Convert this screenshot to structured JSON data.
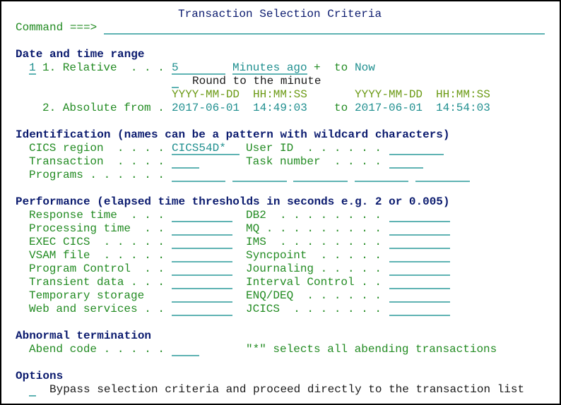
{
  "title": "Transaction Selection Criteria",
  "command": {
    "label": "Command ===>",
    "value": ""
  },
  "date_time_range": {
    "heading": "Date and time range",
    "selected_option": "1",
    "relative": {
      "label": "1. Relative  . . .",
      "amount": "5",
      "unit": "Minutes ago",
      "plus": "+",
      "to": "to",
      "now": "Now",
      "round_value": "",
      "round_label": "Round to the minute"
    },
    "formats": {
      "date": "YYYY-MM-DD",
      "time": "HH:MM:SS"
    },
    "absolute": {
      "label": "2. Absolute from .",
      "from_date": "2017-06-01",
      "from_time": "14:49:03",
      "to": "to",
      "to_date": "2017-06-01",
      "to_time": "14:54:03"
    }
  },
  "identification": {
    "heading": "Identification (names can be a pattern with wildcard characters)",
    "cics_region": {
      "label": "CICS region  . . . .",
      "value": "CICS54D*"
    },
    "user_id": {
      "label": "User ID  . . . . . .",
      "value": ""
    },
    "transaction": {
      "label": "Transaction  . . . .",
      "value": ""
    },
    "task_number": {
      "label": "Task number  . . . .",
      "value": ""
    },
    "programs": {
      "label": "Programs . . . . . .",
      "values": [
        "",
        "",
        "",
        "",
        ""
      ]
    }
  },
  "performance": {
    "heading": "Performance (elapsed time thresholds in seconds e.g. 2 or 0.005)",
    "left": [
      {
        "label": "Response time  . . .",
        "value": ""
      },
      {
        "label": "Processing time  . .",
        "value": ""
      },
      {
        "label": "EXEC CICS  . . . . .",
        "value": ""
      },
      {
        "label": "VSAM file  . . . . .",
        "value": ""
      },
      {
        "label": "Program Control  . .",
        "value": ""
      },
      {
        "label": "Transient data . . .",
        "value": ""
      },
      {
        "label": "Temporary storage",
        "value": ""
      },
      {
        "label": "Web and services . .",
        "value": ""
      }
    ],
    "right": [
      {
        "label": "DB2  . . . . . . . .",
        "value": ""
      },
      {
        "label": "MQ . . . . . . . . .",
        "value": ""
      },
      {
        "label": "IMS  . . . . . . . .",
        "value": ""
      },
      {
        "label": "Syncpoint  . . . . .",
        "value": ""
      },
      {
        "label": "Journaling . . . . .",
        "value": ""
      },
      {
        "label": "Interval Control . .",
        "value": ""
      },
      {
        "label": "ENQ/DEQ  . . . . . .",
        "value": ""
      },
      {
        "label": "JCICS  . . . . . . .",
        "value": ""
      }
    ]
  },
  "abnormal_termination": {
    "heading": "Abnormal termination",
    "abend_code": {
      "label": "Abend code . . . . .",
      "value": ""
    },
    "note": "\"*\" selects all abending transactions"
  },
  "options": {
    "heading": "Options",
    "bypass": {
      "value": "",
      "label": "Bypass selection criteria and proceed directly to the transaction list"
    }
  },
  "colors": {
    "heading": "#0a1a6e",
    "label": "#228b22",
    "input": "#1f8f8f",
    "input_underline": "#5fb3b3",
    "format_hint": "#6b9a14"
  }
}
